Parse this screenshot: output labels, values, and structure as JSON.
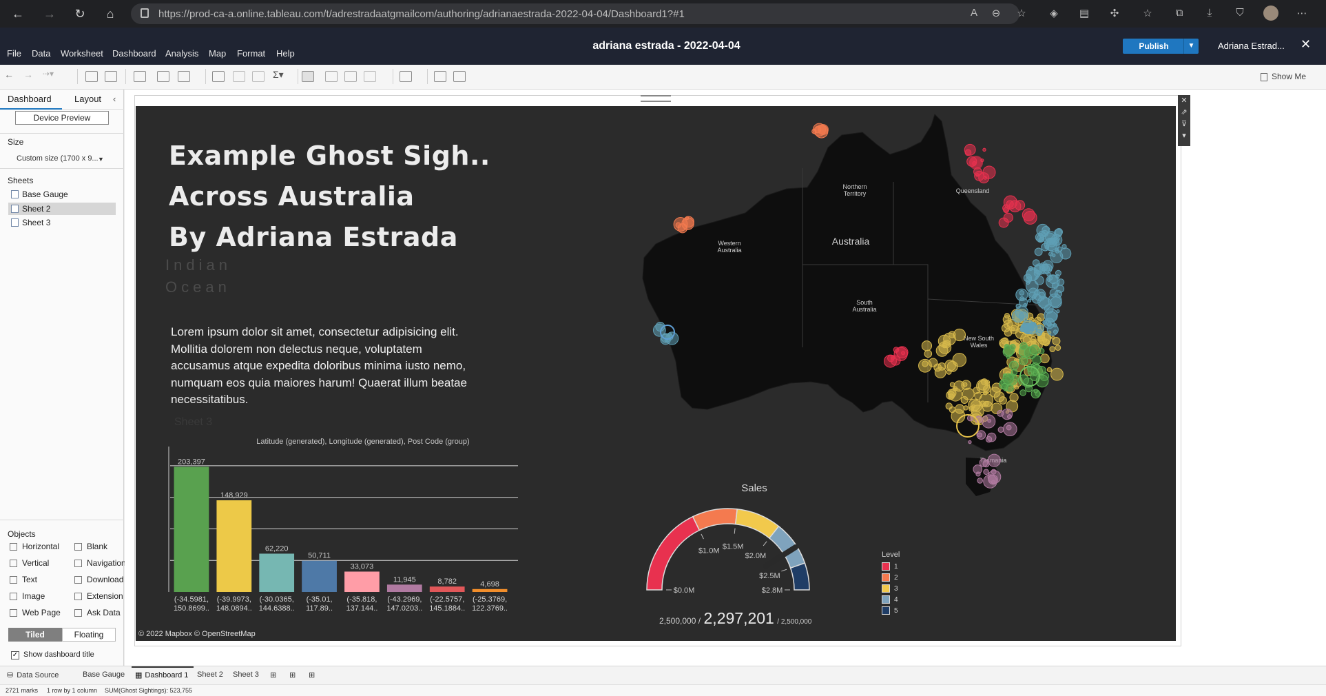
{
  "browser": {
    "url": "https://prod-ca-a.online.tableau.com/t/adrestradaatgmailcom/authoring/adrianaestrada-2022-04-04/Dashboard1?#1",
    "back_icon": "arrow-left-icon",
    "forward_icon": "arrow-right-icon",
    "reload_icon": "reload-icon",
    "home_icon": "home-icon"
  },
  "header": {
    "menus": [
      "File",
      "Data",
      "Worksheet",
      "Dashboard",
      "Analysis",
      "Map",
      "Format",
      "Help"
    ],
    "title": "adriana estrada - 2022-04-04",
    "publish_label": "Publish",
    "user": "Adriana Estrad...",
    "close": "✕"
  },
  "toolbar": {
    "show_me": "Show Me"
  },
  "left_pane": {
    "tabs": [
      "Dashboard",
      "Layout"
    ],
    "device_preview": "Device Preview",
    "size_label": "Size",
    "size_value": "Custom size (1700 x 9...",
    "sheets_label": "Sheets",
    "sheets": [
      "Base Gauge",
      "Sheet 2",
      "Sheet 3"
    ],
    "selected_sheet": "Sheet 2",
    "objects_label": "Objects",
    "objects": [
      {
        "label": "Horizontal",
        "icon": "horizontal-icon"
      },
      {
        "label": "Blank",
        "icon": "blank-icon"
      },
      {
        "label": "Vertical",
        "icon": "vertical-icon"
      },
      {
        "label": "Navigation",
        "icon": "navigation-icon"
      },
      {
        "label": "Text",
        "icon": "text-icon"
      },
      {
        "label": "Download",
        "icon": "download-icon"
      },
      {
        "label": "Image",
        "icon": "image-icon"
      },
      {
        "label": "Extension",
        "icon": "extension-icon"
      },
      {
        "label": "Web Page",
        "icon": "web-page-icon"
      },
      {
        "label": "Ask Data",
        "icon": "ask-data-icon"
      }
    ],
    "tiled": "Tiled",
    "floating": "Floating",
    "show_title_label": "Show dashboard title",
    "show_title_checked": true
  },
  "dashboard": {
    "title_lines": [
      "Example Ghost Sigh..",
      "Across Australia",
      "By Adriana Estrada"
    ],
    "ocean_lines": [
      "Indian",
      "Ocean"
    ],
    "body_text": "Lorem ipsum dolor sit amet, consectetur adipisicing elit. Mollitia dolorem non delectus neque, voluptatem accusamus atque expedita doloribus minima iusto nemo, numquam eos quia maiores harum! Quaerat illum beatae necessitatibus.",
    "ghost_sheet_label": "Sheet 3",
    "map_credit": "© 2022 Mapbox © OpenStreetMap",
    "map_labels": [
      "Northern Territory",
      "Queensland",
      "Western Australia",
      "Australia",
      "South Australia",
      "New South Wales",
      "Tasmania"
    ],
    "gauge": {
      "title": "Sales",
      "ticks": [
        "$0.0M",
        "$1.0M",
        "$1.5M",
        "$2.0M",
        "$2.5M",
        "$2.8M"
      ],
      "min_label": "2,500,000 /",
      "value_label": "2,297,201",
      "max_label": "/ 2,500,000",
      "value": 2297201,
      "max": 2800000,
      "band_colors": [
        "#e8314f",
        "#f47a4f",
        "#f2c94c",
        "#7fa3bd",
        "#1f3d66"
      ]
    },
    "legend": {
      "title": "Level",
      "items": [
        {
          "label": "1",
          "color": "#e8314f"
        },
        {
          "label": "2",
          "color": "#f47a4f"
        },
        {
          "label": "3",
          "color": "#f2c94c"
        },
        {
          "label": "4",
          "color": "#7fa3bd"
        },
        {
          "label": "5",
          "color": "#1f3d66"
        }
      ]
    }
  },
  "chart_data": {
    "type": "bar",
    "title": "Latitude (generated), Longitude (generated), Post Code (group)",
    "categories": [
      [
        "(-34.5981,",
        "150.8699.."
      ],
      [
        "(-39.9973,",
        "148.0894.."
      ],
      [
        "(-30.0365,",
        "144.6388.."
      ],
      [
        "(-35.01,",
        "117.89.."
      ],
      [
        "(-35.818,",
        "137.144.."
      ],
      [
        "(-43.2969,",
        "147.0203.."
      ],
      [
        "(-22.5757,",
        "145.1884.."
      ],
      [
        "(-25.3769,",
        "122.3769.."
      ]
    ],
    "values": [
      203397,
      148929,
      62220,
      50711,
      33073,
      11945,
      8782,
      4698
    ],
    "value_labels": [
      "203,397",
      "148,929",
      "62,220",
      "50,711",
      "33,073",
      "11,945",
      "8,782",
      "4,698"
    ],
    "colors": [
      "#59a14f",
      "#edc948",
      "#76b7b2",
      "#4e79a7",
      "#ff9da7",
      "#b07aa1",
      "#e15759",
      "#f28e2b"
    ],
    "ylim": [
      0,
      205000
    ],
    "grid": true
  },
  "bottom": {
    "tabs": [
      "Data Source",
      "Base Gauge",
      "Dashboard 1",
      "Sheet 2",
      "Sheet 3"
    ],
    "active_tab": "Dashboard 1",
    "status": [
      "2721 marks",
      "1 row by 1 column",
      "SUM(Ghost Sightings): 523,755"
    ]
  }
}
